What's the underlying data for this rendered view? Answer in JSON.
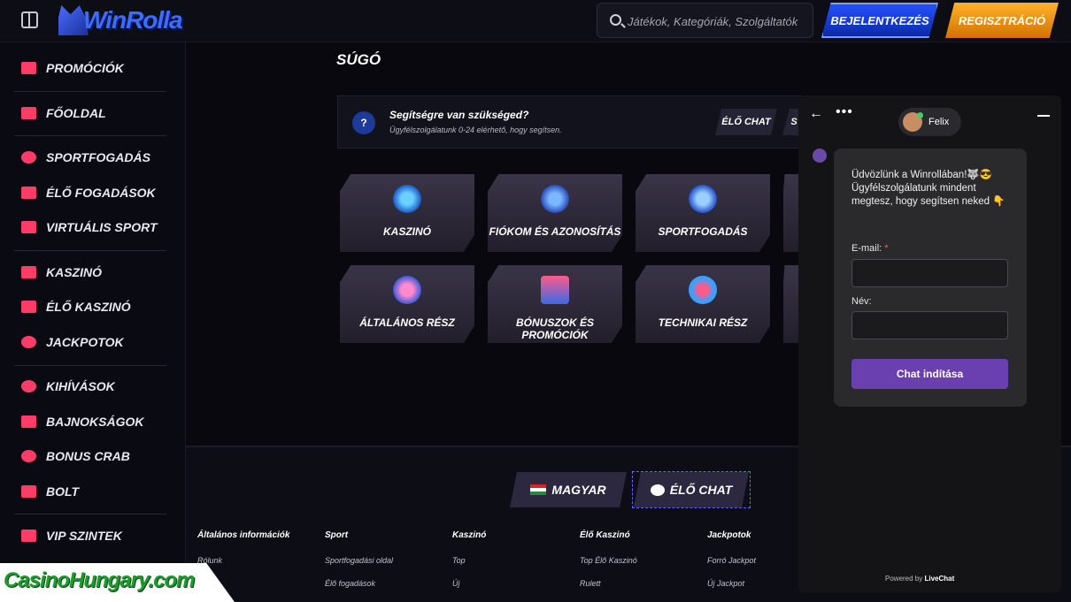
{
  "header": {
    "logo_text": "WinRolla",
    "search_placeholder": "Játékok, Kategóriák, Szolgáltatók",
    "login_label": "Bejelentkezés",
    "register_label": "Regisztráció"
  },
  "sidebar": {
    "items": [
      {
        "label": "Promóciók",
        "icon": "gift-icon"
      },
      {
        "label": "Főoldal",
        "icon": "home-icon"
      },
      {
        "label": "Sportfogadás",
        "icon": "basketball-icon"
      },
      {
        "label": "Élő fogadások",
        "icon": "live-icon"
      },
      {
        "label": "Virtuális sport",
        "icon": "monitor-icon"
      },
      {
        "label": "Kaszinó",
        "icon": "slot-icon"
      },
      {
        "label": "Élő kaszinó",
        "icon": "cards-icon"
      },
      {
        "label": "Jackpotok",
        "icon": "clover-icon"
      },
      {
        "label": "Kihívások",
        "icon": "badge-icon"
      },
      {
        "label": "Bajnokságok",
        "icon": "trophy-icon"
      },
      {
        "label": "Bonus Crab",
        "icon": "crab-icon"
      },
      {
        "label": "Bolt",
        "icon": "basket-icon"
      },
      {
        "label": "VIP szintek",
        "icon": "diamond-icon"
      }
    ]
  },
  "main": {
    "title": "Súgó",
    "help_banner": {
      "title": "Segítségre van szükséged?",
      "subtitle": "Ügyfélszolgálatunk 0-24 elérhető, hogy segítsen.",
      "chat_label": "Élő chat",
      "more_label": "S"
    },
    "categories": [
      {
        "label": "Kaszinó",
        "icon": "roulette-icon"
      },
      {
        "label": "Fiókom és azonosítás",
        "icon": "wolf-icon"
      },
      {
        "label": "Sportfogadás",
        "icon": "soccer-ball-icon"
      },
      {
        "label": "Általános rész",
        "icon": "chips-icon"
      },
      {
        "label": "Bónuszok és promóciók",
        "icon": "gift-box-icon"
      },
      {
        "label": "Technikai rész",
        "icon": "gear-icon"
      }
    ]
  },
  "footer": {
    "language_label": "Magyar",
    "live_chat_label": "Élő chat",
    "columns": [
      {
        "heading": "Általános információk",
        "links": [
          "Rólunk",
          ""
        ]
      },
      {
        "heading": "Sport",
        "links": [
          "Sportfogadási oldal",
          "Élő fogadások"
        ]
      },
      {
        "heading": "Kaszinó",
        "links": [
          "Top",
          "Új"
        ]
      },
      {
        "heading": "Élő Kaszinó",
        "links": [
          "Top Élő Kaszinó",
          "Rulett"
        ]
      },
      {
        "heading": "Jackpotok",
        "links": [
          "Forró Jackpot",
          "Új Jackpot"
        ]
      }
    ]
  },
  "chat": {
    "agent_name": "Felix",
    "greeting": "Üdvözlünk a Winrollában!🐺😎 Ügyfélszolgálatunk mindent megtesz, hogy segítsen neked 👇",
    "email_label": "E-mail:",
    "required_mark": "*",
    "name_label": "Név:",
    "start_button": "Chat indítása",
    "powered_prefix": "Powered by",
    "powered_brand": "LiveChat"
  },
  "watermark": {
    "text": "CasinoHungary.com"
  },
  "colors": {
    "accent_blue": "#2550ff",
    "accent_orange": "#ff9d1c",
    "chat_button": "#6a3fb0",
    "sidebar_icon": "#ff3c67"
  }
}
